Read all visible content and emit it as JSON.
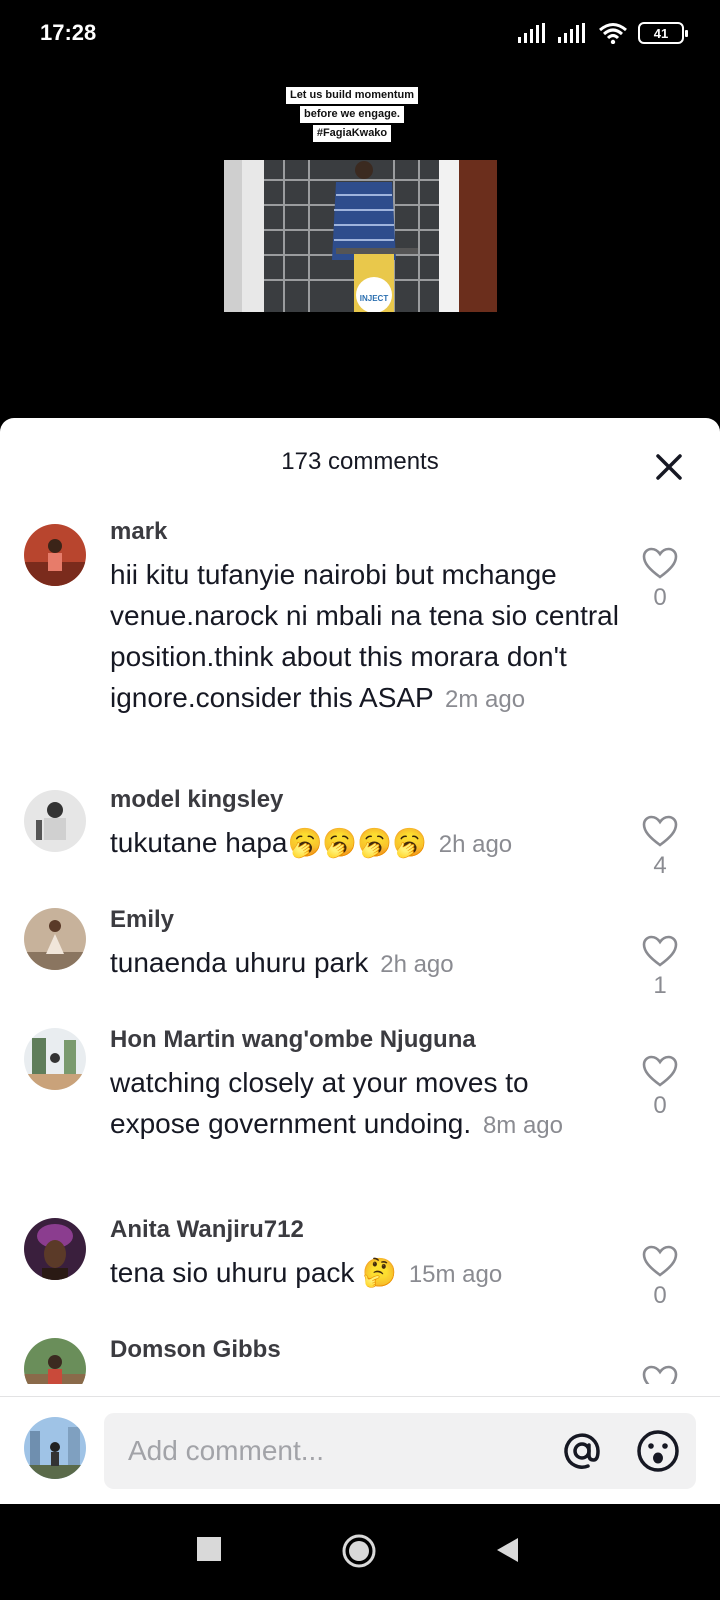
{
  "status_bar": {
    "time": "17:28",
    "battery": "41",
    "icons": [
      "cell-signal-icon",
      "cell-signal-icon",
      "wifi-icon",
      "battery-icon"
    ]
  },
  "video": {
    "caption_lines": [
      "Let us build momentum",
      "before we engage.",
      "#FagiaKwako"
    ],
    "podium_text": "INJECT"
  },
  "sheet": {
    "title": "173 comments"
  },
  "comments": [
    {
      "username": "mark",
      "text": "hii kitu tufanyie nairobi but mchange venue.narock ni mbali na tena sio central position.think about this morara don't ignore.consider this ASAP",
      "time": "2m ago",
      "likes": "0"
    },
    {
      "username": "model kingsley",
      "text": "tukutane hapa🥱🥱🥱🥱",
      "time": "2h ago",
      "likes": "4"
    },
    {
      "username": "Emily",
      "text": "tunaenda uhuru park",
      "time": "2h ago",
      "likes": "1"
    },
    {
      "username": "Hon Martin wang'ombe Njuguna",
      "text": "watching closely at your moves to expose government undoing.",
      "time": "8m ago",
      "likes": "0"
    },
    {
      "username": "Anita Wanjiru712",
      "text": "tena sio uhuru pack 🤔",
      "time": "15m ago",
      "likes": "0"
    },
    {
      "username": "Domson Gibbs",
      "text": "",
      "time": "",
      "likes": ""
    }
  ],
  "input": {
    "placeholder": "Add comment..."
  },
  "colors": {
    "like_icon": "#8a8b91",
    "text": "#161823",
    "muted": "#8a8b91"
  }
}
